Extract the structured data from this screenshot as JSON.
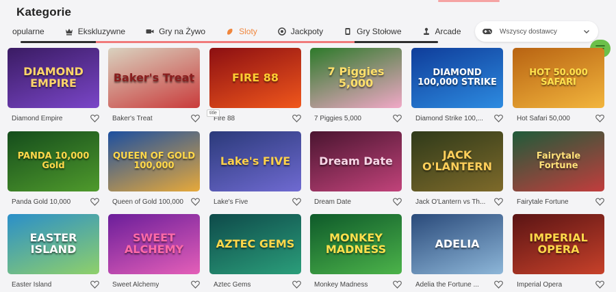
{
  "page": {
    "title": "Kategorie"
  },
  "tabs": [
    {
      "label": "opularne",
      "icon": "star-icon",
      "active": false
    },
    {
      "label": "Ekskluzywne",
      "icon": "crown-icon",
      "active": false
    },
    {
      "label": "Gry na Żywo",
      "icon": "video-camera-icon",
      "active": false
    },
    {
      "label": "Sloty",
      "icon": "slot-icon",
      "active": true
    },
    {
      "label": "Jackpoty",
      "icon": "chip-icon",
      "active": false
    },
    {
      "label": "Gry Stołowe",
      "icon": "card-icon",
      "active": false
    },
    {
      "label": "Arcade",
      "icon": "joystick-icon",
      "active": false
    }
  ],
  "provider": {
    "label": "Wszyscy dostawcy",
    "icon": "gamepad-icon"
  },
  "tooltip": "title",
  "accent": "#f0863c",
  "games": [
    {
      "name": "Diamond Empire",
      "logo": "DIAMOND EMPIRE",
      "bg": "#3a1b63",
      "bg2": "#7a46c8",
      "logo_color": "#ffd56b"
    },
    {
      "name": "Baker's Treat",
      "logo": "Baker's Treat",
      "bg": "#d9d2bf",
      "bg2": "#c93b3b",
      "logo_color": "#8a1d1d"
    },
    {
      "name": "Fire 88",
      "logo": "FIRE 88",
      "bg": "#8c0f12",
      "bg2": "#f0571c",
      "logo_color": "#ffcc33"
    },
    {
      "name": "7 Piggies 5,000",
      "logo": "7 Piggies 5,000",
      "bg": "#2d7a2a",
      "bg2": "#f1a8c7",
      "logo_color": "#ffe06b"
    },
    {
      "name": "Diamond Strike 100,...",
      "logo": "DIAMOND 100,000 STRIKE",
      "bg": "#0f3d9a",
      "bg2": "#2d8be0",
      "logo_color": "#ffffff"
    },
    {
      "name": "Hot Safari 50,000",
      "logo": "HOT 50.000 SAFARI",
      "bg": "#b86312",
      "bg2": "#f2b53d",
      "logo_color": "#ffe14d"
    },
    {
      "name": "Panda Gold 10,000",
      "logo": "PANDA 10,000 Gold",
      "bg": "#154d1c",
      "bg2": "#4f9a2c",
      "logo_color": "#ffd84a"
    },
    {
      "name": "Queen of Gold 100,000",
      "logo": "QUEEN OF GOLD 100,000",
      "bg": "#1c4fa0",
      "bg2": "#e7a93a",
      "logo_color": "#ffd84a"
    },
    {
      "name": "Lake's Five",
      "logo": "Lake's FIVE",
      "bg": "#2b3a7a",
      "bg2": "#6f6ad1",
      "logo_color": "#ffd24a"
    },
    {
      "name": "Dream Date",
      "logo": "Dream Date",
      "bg": "#4a1530",
      "bg2": "#c1437a",
      "logo_color": "#f7d6e6"
    },
    {
      "name": "Jack O'Lantern vs Th...",
      "logo": "JACK O'LANTERN",
      "bg": "#2f3a1a",
      "bg2": "#7e6a2a",
      "logo_color": "#ffcf5a"
    },
    {
      "name": "Fairytale Fortune",
      "logo": "Fairytale Fortune",
      "bg": "#1f5b3a",
      "bg2": "#c23d3d",
      "logo_color": "#ffe07a"
    },
    {
      "name": "Easter Island",
      "logo": "EASTER ISLAND",
      "bg": "#2b8fc9",
      "bg2": "#8fd06a",
      "logo_color": "#ffffff"
    },
    {
      "name": "Sweet Alchemy",
      "logo": "SWEET ALCHEMY",
      "bg": "#6b1e9a",
      "bg2": "#e45fb8",
      "logo_color": "#ff6aa8"
    },
    {
      "name": "Aztec Gems",
      "logo": "AZTEC GEMS",
      "bg": "#0e4a4a",
      "bg2": "#2b9e7a",
      "logo_color": "#ffd84a"
    },
    {
      "name": "Monkey Madness",
      "logo": "MONKEY MADNESS",
      "bg": "#0e5a2a",
      "bg2": "#4cb34a",
      "logo_color": "#ffe14d"
    },
    {
      "name": "Adelia the Fortune ...",
      "logo": "ADELIA",
      "bg": "#2a4a7a",
      "bg2": "#8db6d8",
      "logo_color": "#ffffff"
    },
    {
      "name": "Imperial Opera",
      "logo": "IMPERIAL OPERA",
      "bg": "#5a1414",
      "bg2": "#c7412a",
      "logo_color": "#ffd84a"
    }
  ]
}
